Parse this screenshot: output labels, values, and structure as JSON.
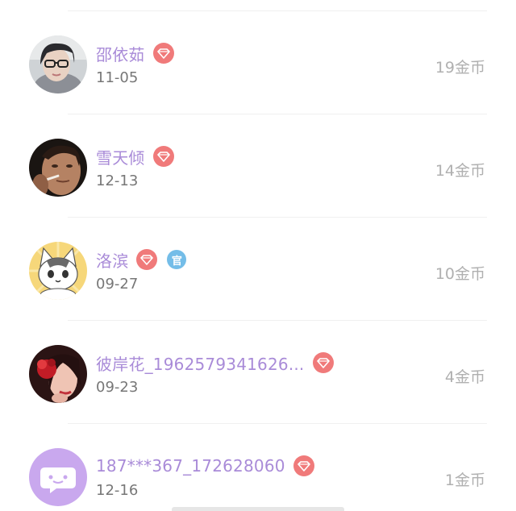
{
  "records": [
    {
      "name": "邵依茹",
      "date": "11-05",
      "coins": "19金币",
      "avatar": "avatar-girl-glasses",
      "vip": true,
      "official": false
    },
    {
      "name": "雪天倾",
      "date": "12-13",
      "coins": "14金币",
      "avatar": "avatar-man-smoking",
      "vip": true,
      "official": false
    },
    {
      "name": "洛滨",
      "date": "09-27",
      "coins": "10金币",
      "avatar": "avatar-cartoon-cat",
      "vip": true,
      "official": true
    },
    {
      "name": "彼岸花_1962579341626...",
      "date": "09-23",
      "coins": "4金币",
      "avatar": "avatar-woman-red-flower",
      "vip": true,
      "official": false
    },
    {
      "name": "187***367_172628060",
      "date": "12-16",
      "coins": "1金币",
      "avatar": "avatar-default-chat",
      "vip": true,
      "official": false
    }
  ],
  "badges": {
    "official_label": "官"
  },
  "colors": {
    "name": "#a98bd8",
    "vip_badge": "#f07a7a",
    "official_badge": "#74bde8",
    "default_avatar": "#c9a8ee"
  }
}
